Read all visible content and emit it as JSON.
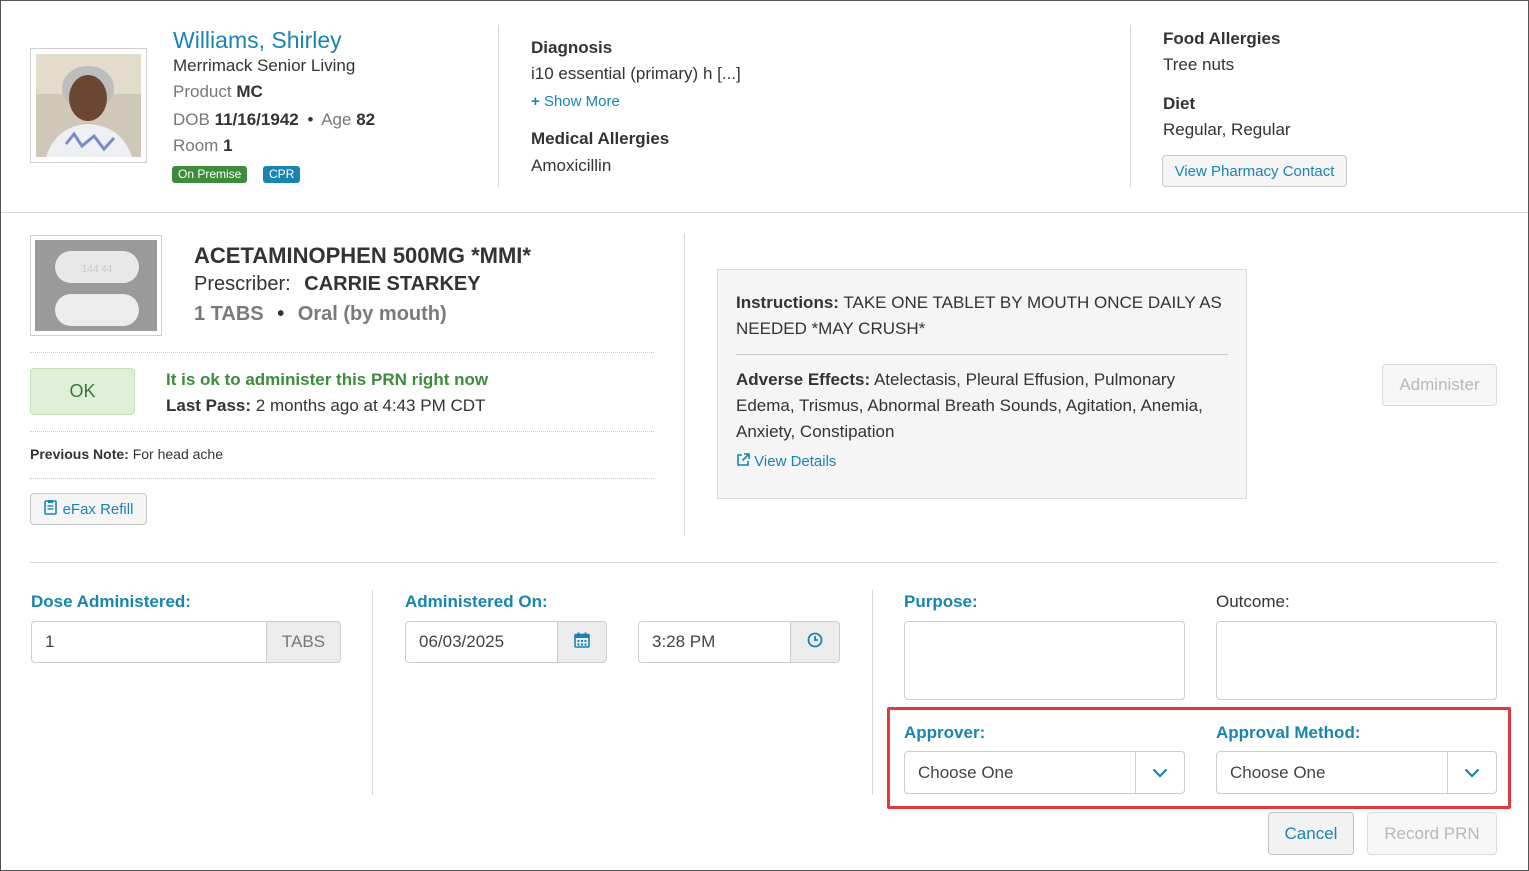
{
  "patient": {
    "name": "Williams, Shirley",
    "facility": "Merrimack Senior Living",
    "product_label": "Product",
    "product_value": "MC",
    "dob_label": "DOB",
    "dob_value": "11/16/1942",
    "bullet": "•",
    "age_label": "Age",
    "age_value": "82",
    "room_label": "Room",
    "room_value": "1",
    "badges": [
      {
        "label": "On Premise",
        "color": "#3c8c3c"
      },
      {
        "label": "CPR",
        "color": "#1a84b0"
      }
    ]
  },
  "diagnosis": {
    "title": "Diagnosis",
    "value": "i10 essential (primary) h [...]",
    "show_more_icon": "+",
    "show_more": "Show More",
    "allergies_title": "Medical Allergies",
    "allergies_value": "Amoxicillin"
  },
  "food": {
    "allergies_title": "Food Allergies",
    "allergies_value": "Tree nuts",
    "diet_title": "Diet",
    "diet_value": "Regular, Regular",
    "pharmacy_button": "View Pharmacy Contact"
  },
  "medication": {
    "pill_imprint": "144 44",
    "name": "ACETAMINOPHEN 500MG *MMI*",
    "prescriber_label": "Prescriber:",
    "prescriber": "CARRIE STARKEY",
    "dose": "1 TABS",
    "bullet": "•",
    "route": "Oral (by mouth)",
    "ok_button": "OK",
    "prn_status": "It is ok to administer this PRN right now",
    "last_pass_label": "Last Pass:",
    "last_pass_value": "2 months ago at 4:43 PM CDT",
    "previous_note_label": "Previous Note:",
    "previous_note_value": "For head ache",
    "efax_button": "eFax Refill"
  },
  "instructions": {
    "label": "Instructions:",
    "value": "TAKE ONE TABLET BY MOUTH ONCE DAILY AS NEEDED *MAY CRUSH*",
    "adverse_label": "Adverse Effects:",
    "adverse_value": "Atelectasis, Pleural Effusion, Pulmonary Edema, Trismus, Abnormal Breath Sounds, Agitation, Anemia, Anxiety, Constipation",
    "view_details": "View Details"
  },
  "administer_button": "Administer",
  "form": {
    "dose_label": "Dose Administered:",
    "dose_value": "1",
    "dose_unit": "TABS",
    "administered_on_label": "Administered On:",
    "date_value": "06/03/2025",
    "time_value": "3:28 PM",
    "purpose_label": "Purpose:",
    "outcome_label": "Outcome:",
    "approver_label": "Approver:",
    "approver_value": "Choose One",
    "approval_method_label": "Approval Method:",
    "approval_method_value": "Choose One",
    "cancel_button": "Cancel",
    "record_button": "Record PRN"
  },
  "colors": {
    "accent": "#1a84b0",
    "success": "#3c8c3c",
    "highlight": "#e0393e"
  }
}
